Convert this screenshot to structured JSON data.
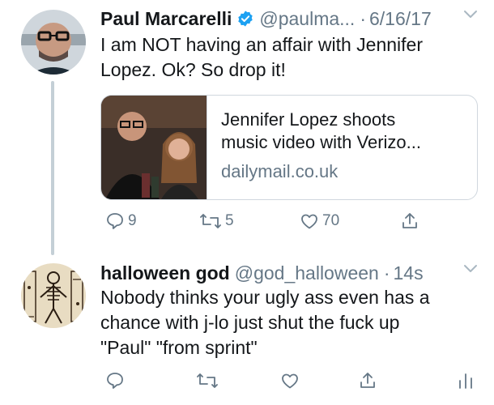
{
  "tweets": [
    {
      "display_name": "Paul Marcarelli",
      "verified": true,
      "handle": "@paulma...",
      "separator": "·",
      "time": "6/16/17",
      "text_lines": [
        "I am NOT having an affair with Jennifer",
        "Lopez. Ok? So drop it!"
      ],
      "card": {
        "title_line1": "Jennifer Lopez shoots",
        "title_line2": "music video with Verizo...",
        "domain": "dailymail.co.uk"
      },
      "actions": {
        "reply_count": "9",
        "retweet_count": "5",
        "like_count": "70"
      }
    },
    {
      "display_name": "halloween god",
      "handle": "@god_halloween",
      "separator": "·",
      "time": "14s",
      "text_lines": [
        "Nobody thinks your ugly ass even has a",
        "chance with j-lo just shut the fuck up",
        "\"Paul\" \"from sprint\""
      ]
    }
  ],
  "colors": {
    "text": "#14171a",
    "secondary": "#657786",
    "verified": "#1da1f2",
    "border": "#d0d7de",
    "thread_line": "#c4cfd6"
  },
  "icons": [
    "verified-badge-icon",
    "chevron-down-icon",
    "reply-icon",
    "retweet-icon",
    "like-icon",
    "share-icon",
    "analytics-icon"
  ]
}
